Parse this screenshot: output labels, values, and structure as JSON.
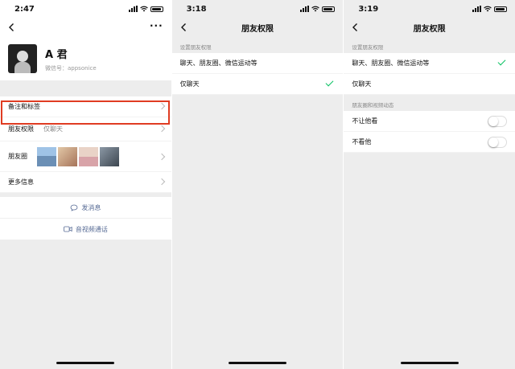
{
  "panels": [
    {
      "status": {
        "time": "2:47"
      },
      "profile": {
        "name": "A 君",
        "wechat_id": "微信号：appsonice"
      },
      "rows": {
        "remark_label": "备注和标签",
        "permission_label": "朋友权限",
        "permission_value": "仅聊天",
        "moments_label": "朋友圈",
        "more_label": "更多信息"
      },
      "moments_thumbs": [
        {
          "icon": "photo-blue",
          "color": "#6b8fb5"
        },
        {
          "icon": "photo-warm",
          "color": "#c9a27e"
        },
        {
          "icon": "photo-pink",
          "color": "#d8a3a8"
        },
        {
          "icon": "photo-dark",
          "color": "#5f6b77"
        }
      ],
      "actions": {
        "message": "发消息",
        "call": "音视频通话"
      }
    },
    {
      "status": {
        "time": "3:18"
      },
      "title": "朋友权限",
      "section_caption": "设置朋友权限",
      "options": [
        "聊天、朋友圈、微信运动等",
        "仅聊天"
      ],
      "selected_index": 1
    },
    {
      "status": {
        "time": "3:19"
      },
      "title": "朋友权限",
      "section_caption": "设置朋友权限",
      "options": [
        "聊天、朋友圈、微信运动等",
        "仅聊天"
      ],
      "selected_index": 0,
      "moments_caption": "朋友圈和视频动态",
      "toggles": [
        {
          "label": "不让他看",
          "on": false
        },
        {
          "label": "不看他",
          "on": false
        }
      ]
    }
  ],
  "colors": {
    "highlight": "#e03c22",
    "check": "#07c160",
    "link": "#576b95",
    "background": "#ededed"
  }
}
